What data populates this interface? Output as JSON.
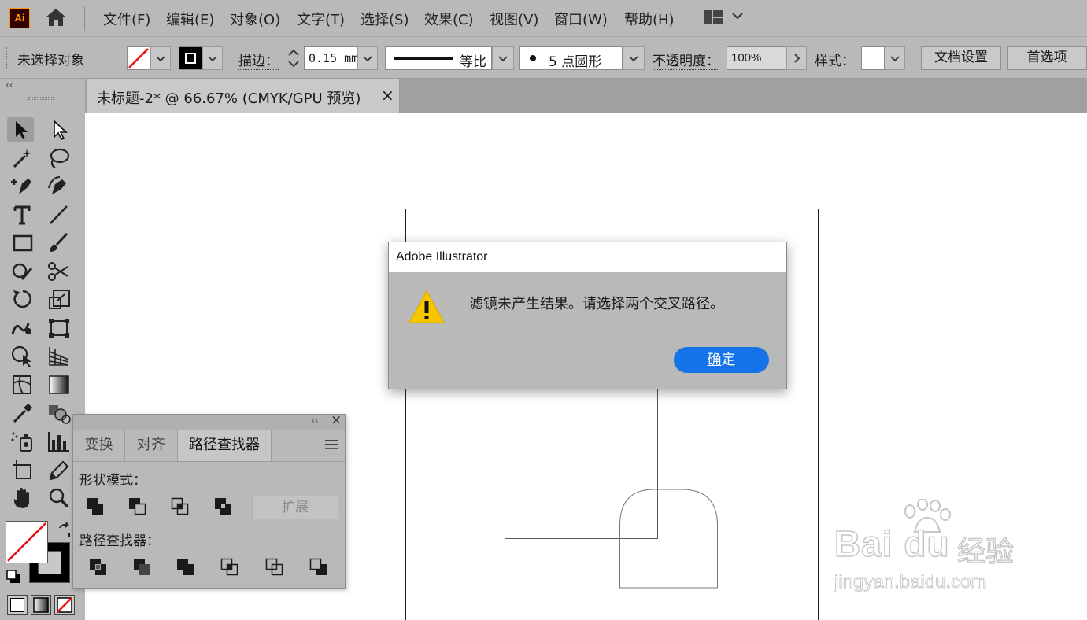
{
  "app": {
    "logo_text": "Ai"
  },
  "menu": [
    "文件(F)",
    "编辑(E)",
    "对象(O)",
    "文字(T)",
    "选择(S)",
    "效果(C)",
    "视图(V)",
    "窗口(W)",
    "帮助(H)"
  ],
  "control_bar": {
    "selection_status": "未选择对象",
    "stroke_label": "描边：",
    "stroke_weight": "0.15 mm",
    "profile_label": "等比",
    "brush_label": "5 点圆形",
    "opacity_label": "不透明度：",
    "opacity_value": "100%",
    "style_label": "样式：",
    "doc_setup_button": "文档设置",
    "preferences_button": "首选项"
  },
  "document": {
    "tab_title": "未标题-2* @ 66.67% (CMYK/GPU 预览)",
    "close_glyph": "×"
  },
  "toolbar": {
    "collapse_glyph": "‹‹"
  },
  "pathfinder_panel": {
    "collapse_glyph": "‹‹",
    "close_glyph": "×",
    "tabs": [
      "变换",
      "对齐",
      "路径查找器"
    ],
    "active_tab": "路径查找器",
    "shape_modes_label": "形状模式：",
    "expand_button": "扩展",
    "pathfinders_label": "路径查找器："
  },
  "dialog": {
    "title": "Adobe Illustrator",
    "message": "滤镜未产生结果。请选择两个交叉路径。",
    "ok_button_mnemonic": "确",
    "ok_button_rest": "定"
  },
  "watermark": {
    "brand": "Bai du",
    "brand_suffix": "经验",
    "url": "jingyan.baidu.com"
  },
  "colors": {
    "accent": "#1473e6",
    "warning": "#f7c600",
    "app_orange": "#ff9a00",
    "none_red": "#e81010"
  }
}
